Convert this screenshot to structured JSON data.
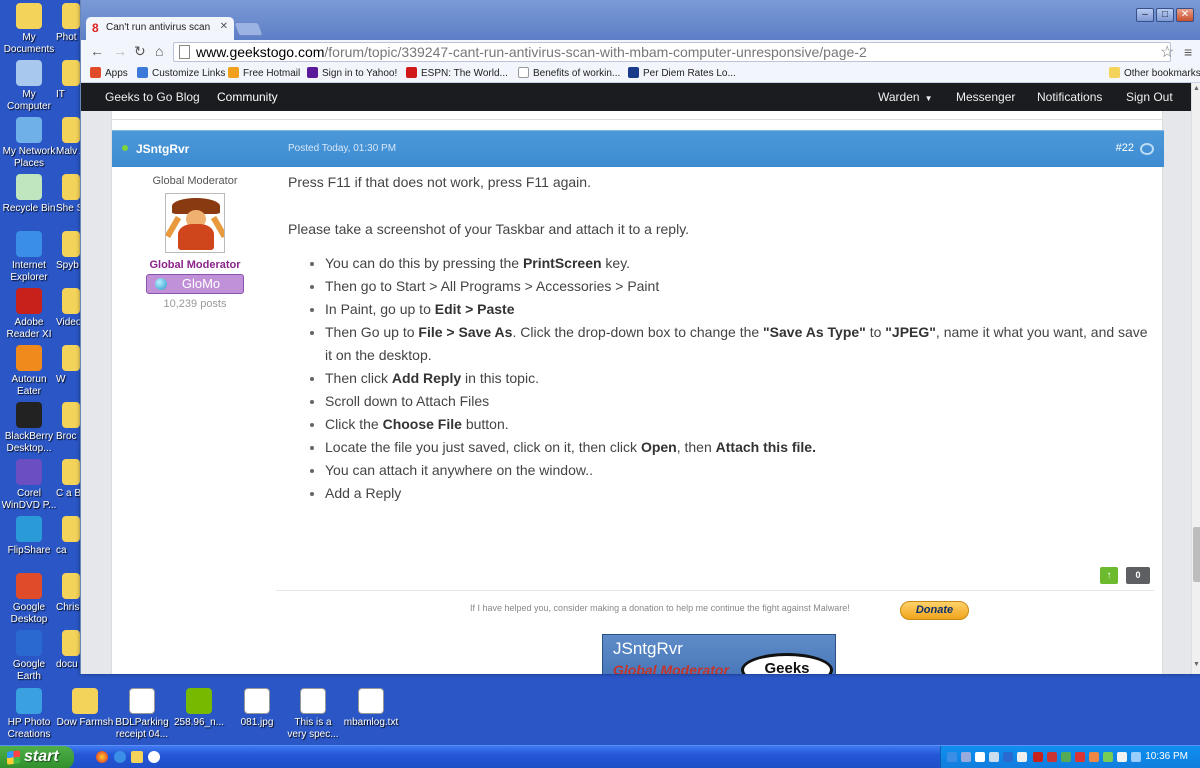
{
  "desktop": {
    "icons_col1": [
      {
        "label": "My Documents",
        "icon": "folder-icon",
        "color": "#f4d35a"
      },
      {
        "label": "My Computer",
        "icon": "computer-icon",
        "color": "#a9c8ee"
      },
      {
        "label": "My Network Places",
        "icon": "network-icon",
        "color": "#6fb0e8"
      },
      {
        "label": "Recycle Bin",
        "icon": "recycle-bin-icon",
        "color": "#bfe6bf"
      },
      {
        "label": "Internet Explorer",
        "icon": "internet-explorer-icon",
        "color": "#3a8ee6"
      },
      {
        "label": "Adobe Reader XI",
        "icon": "adobe-reader-icon",
        "color": "#c8211c"
      },
      {
        "label": "Autorun Eater",
        "icon": "autorun-eater-icon",
        "color": "#f08a1c"
      },
      {
        "label": "BlackBerry Desktop...",
        "icon": "blackberry-icon",
        "color": "#222222"
      },
      {
        "label": "Corel WinDVD P...",
        "icon": "corel-windvd-icon",
        "color": "#6a4ec2"
      },
      {
        "label": "FlipShare",
        "icon": "flipshare-icon",
        "color": "#2a9ad8"
      },
      {
        "label": "Google Desktop",
        "icon": "google-desktop-icon",
        "color": "#e04b2a"
      },
      {
        "label": "Google Earth",
        "icon": "google-earth-icon",
        "color": "#2a6ad0"
      },
      {
        "label": "HP Photo Creations",
        "icon": "hp-photo-icon",
        "color": "#3aa0e0"
      }
    ],
    "icons_col2": [
      {
        "label": "Phot",
        "color": "#f4d35a"
      },
      {
        "label": "IT",
        "color": "#f4d35a"
      },
      {
        "label": "Malv Anti-",
        "color": "#f4d35a"
      },
      {
        "label": "She Supp",
        "color": "#f4d35a"
      },
      {
        "label": "Spyb",
        "color": "#f4d35a"
      },
      {
        "label": "Video Cor",
        "color": "#f4d35a"
      },
      {
        "label": "W",
        "color": "#f4d35a"
      },
      {
        "label": "Broc",
        "color": "#f4d35a"
      },
      {
        "label": "C a Bea",
        "color": "#f4d35a"
      },
      {
        "label": "ca",
        "color": "#f4d35a"
      },
      {
        "label": "Chris",
        "color": "#f4d35a"
      },
      {
        "label": "docu",
        "color": "#f4d35a"
      }
    ],
    "icons_bottom": [
      {
        "label": "Dow Farmsh",
        "icon": "folder-icon",
        "color": "#f4d35a"
      },
      {
        "label": "BDLParking receipt 04...",
        "icon": "pdf-file-icon",
        "color": "#ffffff"
      },
      {
        "label": "258.96_n...",
        "icon": "nvidia-icon",
        "color": "#76b900"
      },
      {
        "label": "081.jpg",
        "icon": "image-file-icon",
        "color": "#ffffff"
      },
      {
        "label": "This is a very spec...",
        "icon": "word-document-icon",
        "color": "#ffffff"
      },
      {
        "label": "mbamlog.txt",
        "icon": "text-file-icon",
        "color": "#ffffff"
      }
    ]
  },
  "browser": {
    "tab_title": "Can't run antivirus scan",
    "url_host": "www.geekstogo.com",
    "url_path": "/forum/topic/339247-cant-run-antivirus-scan-with-mbam-computer-unresponsive/page-2",
    "bookmarks": [
      {
        "label": "Apps",
        "color": "#e04b2a"
      },
      {
        "label": "Customize Links",
        "color": "#3b7ad8"
      },
      {
        "label": "Free Hotmail",
        "color": "#f0a01c"
      },
      {
        "label": "Sign in to Yahoo!",
        "color": "#5a1a9a"
      },
      {
        "label": "ESPN: The World...",
        "color": "#d01a1a"
      },
      {
        "label": "Benefits of workin...",
        "color": "#ffffff"
      },
      {
        "label": "Per Diem Rates Lo...",
        "color": "#1a3a8a"
      }
    ],
    "other_bookmarks": "Other bookmarks"
  },
  "site_nav": {
    "left": [
      "Geeks to Go Blog",
      "Community"
    ],
    "right": [
      "Warden",
      "Messenger",
      "Notifications",
      "Sign Out"
    ]
  },
  "post": {
    "author": "JSntgRvr",
    "posted": "Posted Today, 01:30 PM",
    "number": "#22",
    "role_top": "Global Moderator",
    "role_name": "Global Moderator",
    "badge": "GloMo",
    "post_count": "10,239 posts",
    "p1": "Press F11 if that does not work, press F11 again.",
    "p2": "Please take a screenshot of your Taskbar and attach it to a reply.",
    "list": [
      [
        "You can do this by pressing the ",
        {
          "b": "PrintScreen"
        },
        " key."
      ],
      [
        "Then go to Start > All Programs > Accessories > Paint"
      ],
      [
        "In Paint, go up to ",
        {
          "b": "Edit > Paste"
        }
      ],
      [
        "Then Go up to ",
        {
          "b": "File > Save As"
        },
        ". Click the drop-down box to change the ",
        {
          "b": "\"Save As Type\""
        },
        " to ",
        {
          "b": "\"JPEG\""
        },
        ", name it what you want, and save it on the desktop."
      ],
      [
        "Then click ",
        {
          "b": "Add Reply"
        },
        " in this topic."
      ],
      [
        "Scroll down to Attach Files"
      ],
      [
        "Click the ",
        {
          "b": "Choose File"
        },
        " button."
      ],
      [
        "Locate the file you just saved, click on it, then click ",
        {
          "b": "Open"
        },
        ", then ",
        {
          "b": "Attach this file."
        }
      ],
      [
        "You can attach it anywhere on the window.."
      ],
      [
        "Add a Reply"
      ]
    ],
    "vote_count": "0",
    "donate_text": "If I have helped you, consider making a donation to help me continue the fight against Malware!",
    "donate_button": "Donate",
    "sig_name": "JSntgRvr",
    "sig_role": "Global Moderator",
    "sig_logo": "Geeks"
  },
  "taskbar": {
    "start": "start",
    "clock": "10:36 PM"
  }
}
